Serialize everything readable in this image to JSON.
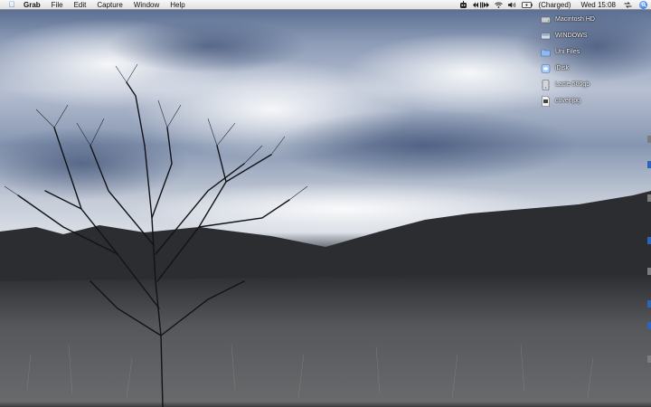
{
  "menubar": {
    "app_name": "Grab",
    "menus": [
      "File",
      "Edit",
      "Capture",
      "Window",
      "Help"
    ],
    "battery_status": "(Charged)",
    "clock": "Wed 15:08"
  },
  "desktop": {
    "icons": [
      {
        "label": "Macintosh HD",
        "icon": "hard-drive-icon"
      },
      {
        "label": "WINDOWS",
        "icon": "hard-drive-icon"
      },
      {
        "label": "Uni Files",
        "icon": "folder-icon"
      },
      {
        "label": "iDisk",
        "icon": "idisk-icon"
      },
      {
        "label": "Lacie 500gb",
        "icon": "external-drive-icon"
      },
      {
        "label": "cover.jpg",
        "icon": "image-file-icon"
      }
    ]
  },
  "colors": {
    "menubar_bg": "#e9e9e9",
    "apple_blue": "#3a6fc9",
    "spotlight_blue": "#1f5fd0"
  }
}
